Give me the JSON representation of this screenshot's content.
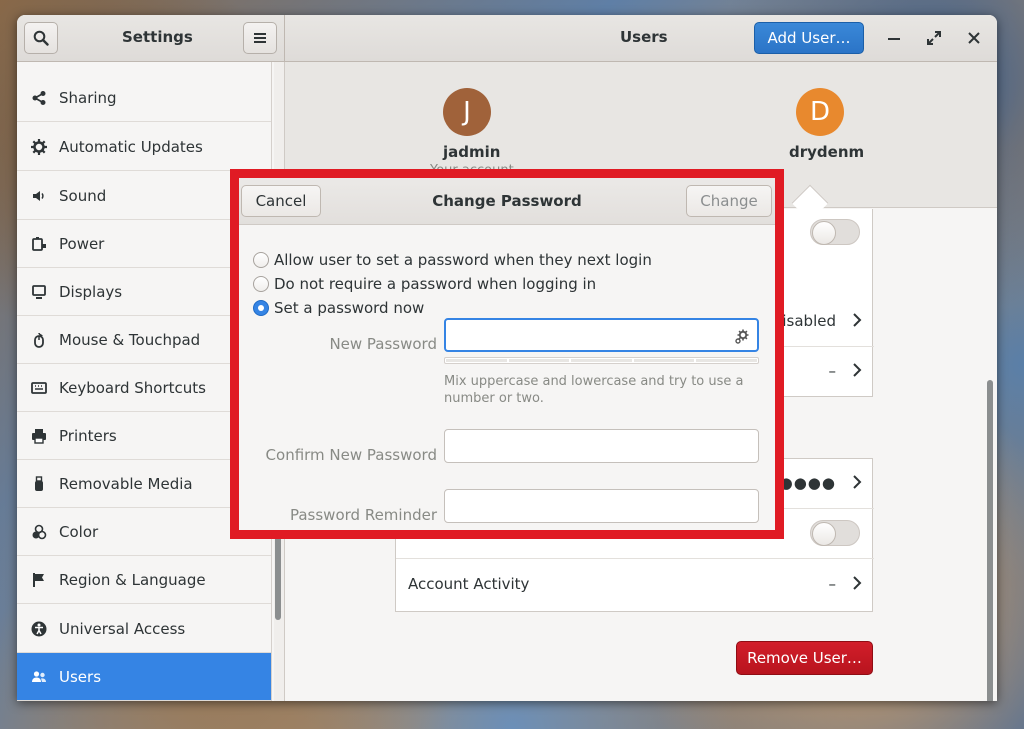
{
  "window": {
    "sidebar_title": "Settings",
    "content_title": "Users",
    "add_user_label": "Add User…"
  },
  "sidebar": {
    "items": [
      {
        "label": "Sharing",
        "icon": "share-icon"
      },
      {
        "label": "Automatic Updates",
        "icon": "gear-icon"
      },
      {
        "label": "Sound",
        "icon": "speaker-icon"
      },
      {
        "label": "Power",
        "icon": "power-icon"
      },
      {
        "label": "Displays",
        "icon": "display-icon"
      },
      {
        "label": "Mouse & Touchpad",
        "icon": "mouse-icon"
      },
      {
        "label": "Keyboard Shortcuts",
        "icon": "keyboard-icon"
      },
      {
        "label": "Printers",
        "icon": "printer-icon"
      },
      {
        "label": "Removable Media",
        "icon": "usb-icon"
      },
      {
        "label": "Color",
        "icon": "color-icon"
      },
      {
        "label": "Region & Language",
        "icon": "flag-icon"
      },
      {
        "label": "Universal Access",
        "icon": "accessibility-icon"
      },
      {
        "label": "Users",
        "icon": "users-icon",
        "active": true
      }
    ]
  },
  "users": [
    {
      "initial": "J",
      "name": "jadmin",
      "subtitle": "Your account",
      "color": "#a0623a"
    },
    {
      "initial": "D",
      "name": "drydenm",
      "color": "#e8892e"
    }
  ],
  "details": {
    "language_value": "Disabled",
    "dash_value": "–",
    "password_value": "●●●●●",
    "account_activity_label": "Account Activity",
    "account_activity_value": "–",
    "remove_user_label": "Remove User…"
  },
  "dialog": {
    "title": "Change Password",
    "cancel_label": "Cancel",
    "change_label": "Change",
    "options": [
      {
        "label": "Allow user to set a password when they next login",
        "checked": false
      },
      {
        "label": "Do not require a password when logging in",
        "checked": false
      },
      {
        "label": "Set a password now",
        "checked": true
      }
    ],
    "new_password_label": "New Password",
    "new_password_value": "",
    "hint": "Mix uppercase and lowercase and try to use a number or two.",
    "confirm_label": "Confirm New Password",
    "confirm_value": "",
    "reminder_label": "Password Reminder",
    "reminder_value": ""
  },
  "colors": {
    "accent": "#3584e4",
    "destructive": "#c0151f",
    "highlight_frame": "#e01b24"
  }
}
